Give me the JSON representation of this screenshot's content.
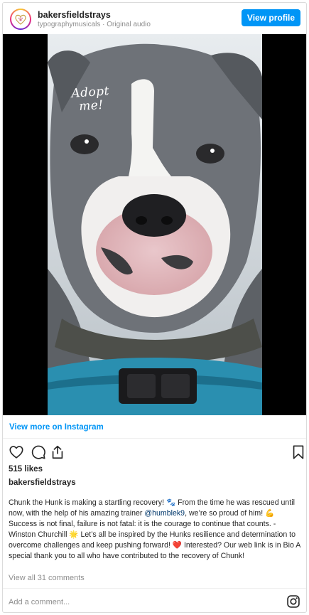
{
  "header": {
    "username": "bakersfieldstrays",
    "subtitle": "typographymusicals · Original audio",
    "view_profile_label": "View profile"
  },
  "media": {
    "overlay_text_line1": "Adopt",
    "overlay_text_line2": "me!"
  },
  "view_more_label": "View more on Instagram",
  "actions": {
    "icons": [
      "heart-icon",
      "comment-icon",
      "share-icon",
      "bookmark-icon"
    ]
  },
  "likes_text": "515 likes",
  "caption": {
    "username": "bakersfieldstrays",
    "text_before_mention": "Chunk the Hunk is making a startling recovery! 🐾 From the time he was rescued until now, with the help of his amazing trainer ",
    "mention": "@humblek9",
    "text_after_mention": ", we’re so proud of him! 💪 Success is not final, failure is not fatal: it is the courage to continue that counts. - Winston Churchill 🌟 Let’s all be inspired by the Hunks resilience and determination to overcome challenges and keep pushing forward! ❤️ Interested? Our web link is in Bio A special thank you to all who have contributed to the recovery of Chunk!"
  },
  "comments_link": "View all 31 comments",
  "add_comment_placeholder": "Add a comment...",
  "colors": {
    "accent_blue": "#0095f6",
    "mention": "#00376b",
    "muted": "#8e8e8e"
  }
}
